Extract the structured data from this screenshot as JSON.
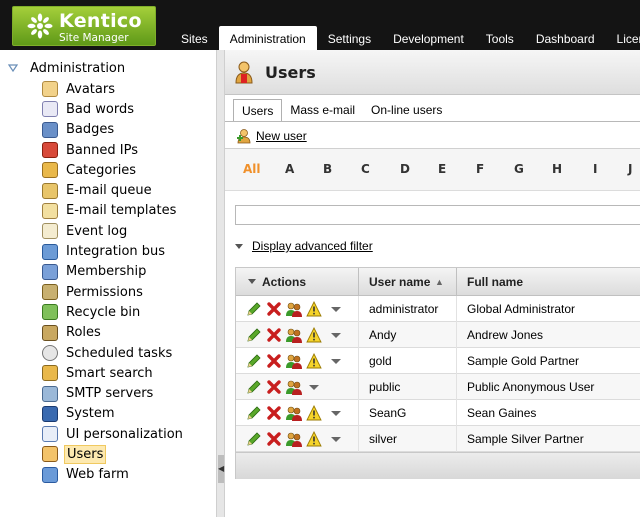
{
  "app": {
    "logo_name": "Kentico",
    "logo_subtitle": "Site Manager",
    "top_tabs": [
      "Sites",
      "Administration",
      "Settings",
      "Development",
      "Tools",
      "Dashboard",
      "Licenses"
    ],
    "active_top_tab": "Administration"
  },
  "tree": {
    "root_label": "Administration",
    "items": [
      {
        "label": "Avatars",
        "icon": "avatar-icon"
      },
      {
        "label": "Bad words",
        "icon": "bad-words-icon"
      },
      {
        "label": "Badges",
        "icon": "badge-icon"
      },
      {
        "label": "Banned IPs",
        "icon": "banned-ip-icon"
      },
      {
        "label": "Categories",
        "icon": "category-icon"
      },
      {
        "label": "E-mail queue",
        "icon": "email-queue-icon"
      },
      {
        "label": "E-mail templates",
        "icon": "email-template-icon"
      },
      {
        "label": "Event log",
        "icon": "event-log-icon"
      },
      {
        "label": "Integration bus",
        "icon": "integration-bus-icon"
      },
      {
        "label": "Membership",
        "icon": "membership-icon"
      },
      {
        "label": "Permissions",
        "icon": "permissions-icon"
      },
      {
        "label": "Recycle bin",
        "icon": "recycle-bin-icon"
      },
      {
        "label": "Roles",
        "icon": "roles-icon"
      },
      {
        "label": "Scheduled tasks",
        "icon": "scheduled-tasks-icon"
      },
      {
        "label": "Smart search",
        "icon": "smart-search-icon"
      },
      {
        "label": "SMTP servers",
        "icon": "smtp-servers-icon"
      },
      {
        "label": "System",
        "icon": "system-icon"
      },
      {
        "label": "UI personalization",
        "icon": "ui-personalization-icon"
      },
      {
        "label": "Users",
        "icon": "users-icon"
      },
      {
        "label": "Web farm",
        "icon": "web-farm-icon"
      }
    ],
    "selected": "Users"
  },
  "page": {
    "title": "Users",
    "subtabs": [
      "Users",
      "Mass e-mail",
      "On-line users"
    ],
    "active_subtab": "Users",
    "new_user_label": "New user",
    "letters": [
      "All",
      "A",
      "B",
      "C",
      "D",
      "E",
      "F",
      "G",
      "H",
      "I",
      "J"
    ],
    "active_letter": "All",
    "search_value": "",
    "advanced_filter_label": "Display advanced filter"
  },
  "grid": {
    "columns": {
      "actions": "Actions",
      "user_name": "User name",
      "full_name": "Full name"
    },
    "sort_indicator": "▲",
    "rows": [
      {
        "user_name": "administrator",
        "full_name": "Global Administrator",
        "has_warning": true
      },
      {
        "user_name": "Andy",
        "full_name": "Andrew Jones",
        "has_warning": true
      },
      {
        "user_name": "gold",
        "full_name": "Sample Gold Partner",
        "has_warning": true
      },
      {
        "user_name": "public",
        "full_name": "Public Anonymous User",
        "has_warning": false
      },
      {
        "user_name": "SeanG",
        "full_name": "Sean Gaines",
        "has_warning": true
      },
      {
        "user_name": "silver",
        "full_name": "Sample Silver Partner",
        "has_warning": true
      }
    ]
  },
  "colors": {
    "header_bg": "#141414",
    "logo_green": "#7fb52a",
    "active_letter": "#f0902a",
    "selection_bg": "#fde9b0"
  }
}
